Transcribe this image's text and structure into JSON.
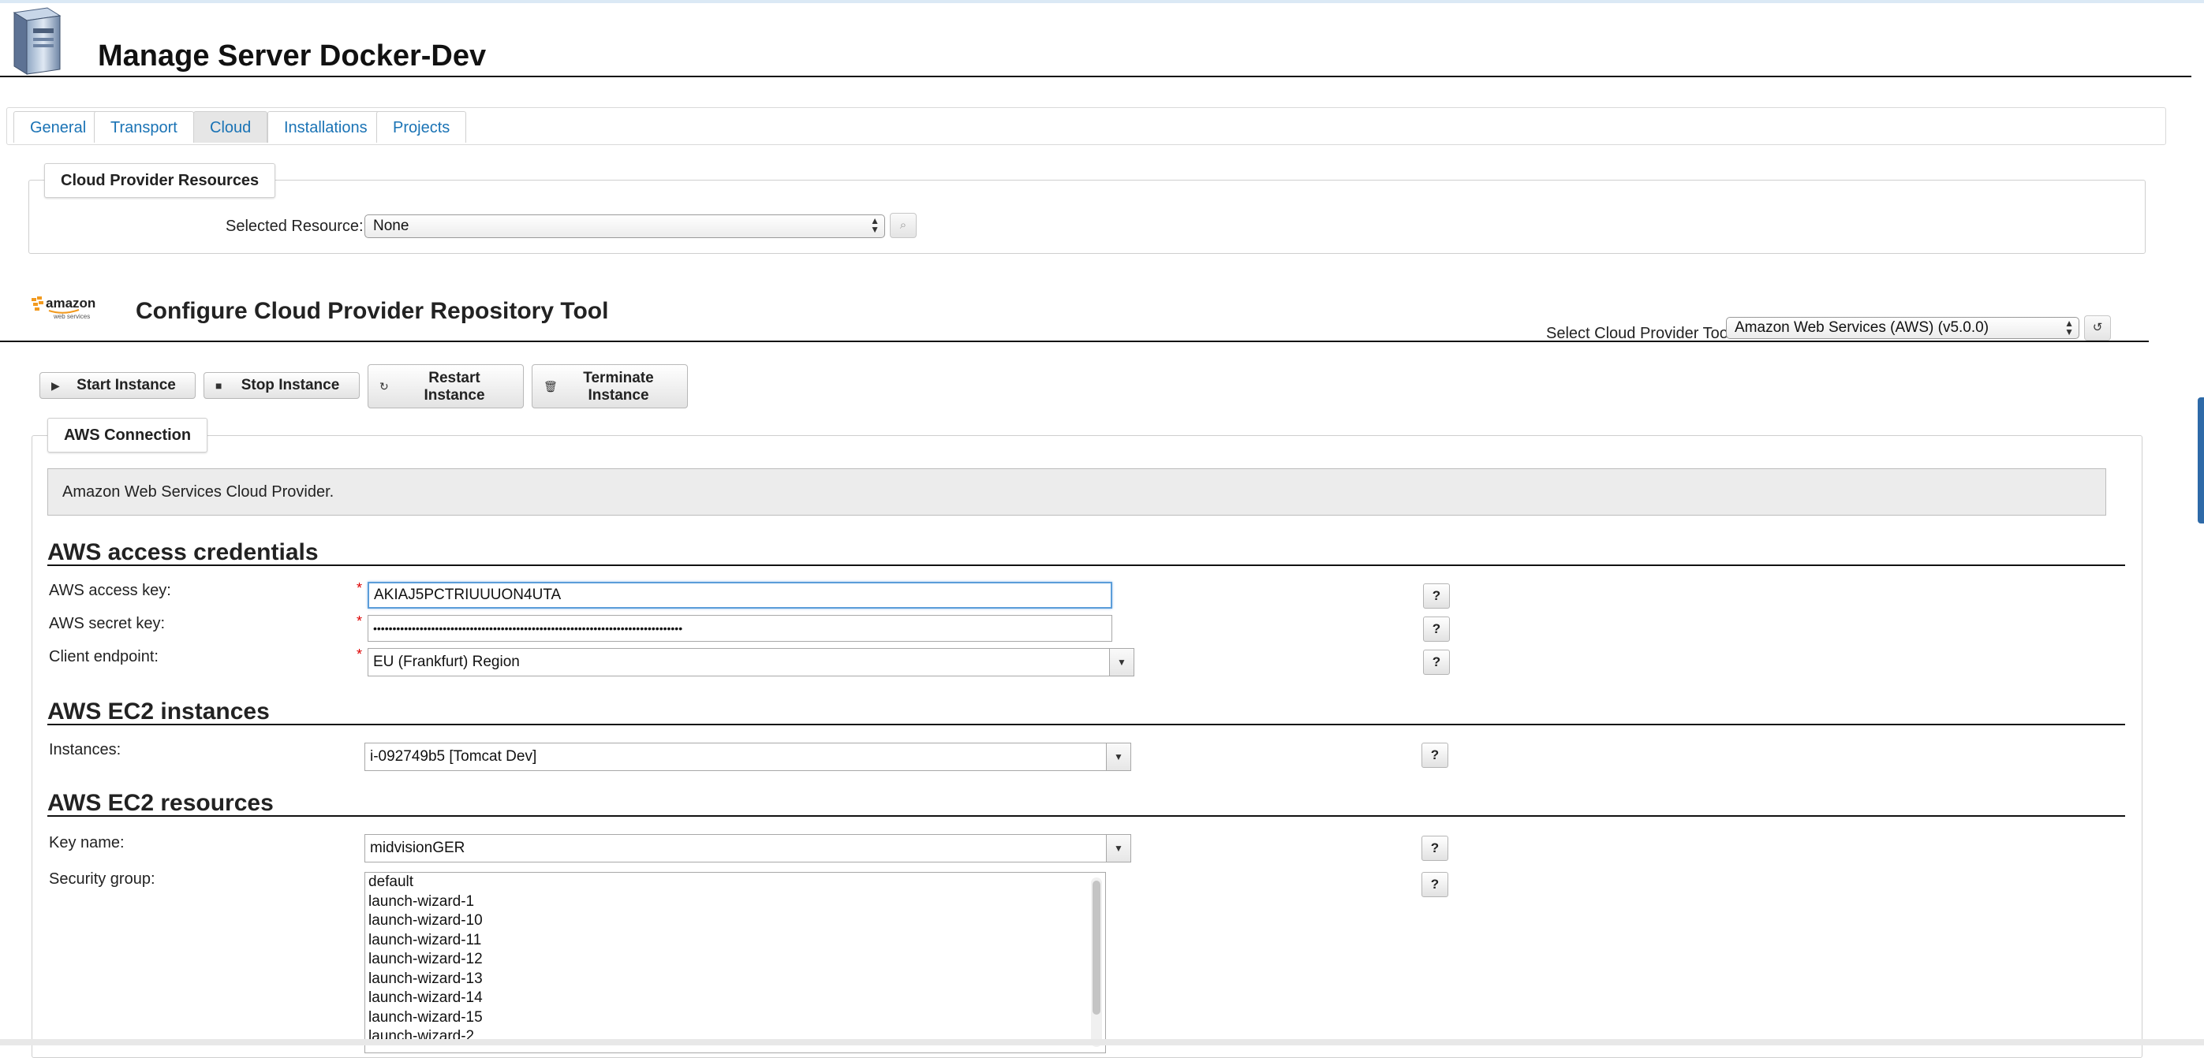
{
  "header": {
    "title": "Manage Server Docker-Dev",
    "icon": "server-icon"
  },
  "tabs": [
    {
      "label": "General",
      "active": false
    },
    {
      "label": "Transport",
      "active": false
    },
    {
      "label": "Cloud",
      "active": true
    },
    {
      "label": "Installations",
      "active": false
    },
    {
      "label": "Projects",
      "active": false
    }
  ],
  "cloud_resources": {
    "legend": "Cloud Provider Resources",
    "selected_label": "Selected Resource:",
    "selected_value": "None"
  },
  "tool": {
    "title": "Configure Cloud Provider Repository Tool",
    "select_label": "Select Cloud Provider Tool",
    "select_value": "Amazon Web Services (AWS) (v5.0.0)",
    "logo_main": "amazon",
    "logo_sub": "web services"
  },
  "actions": {
    "start": "Start Instance",
    "stop": "Stop Instance",
    "restart_1": "Restart",
    "restart_2": "Instance",
    "terminate_1": "Terminate",
    "terminate_2": "Instance"
  },
  "connection": {
    "legend": "AWS Connection",
    "info": "Amazon Web Services Cloud Provider."
  },
  "credentials": {
    "title": "AWS access credentials",
    "access_key_label": "AWS access key:",
    "access_key_value": "AKIAJ5PCTRIUUUON4UTA",
    "secret_key_label": "AWS secret key:",
    "secret_key_value": "••••••••••••••••••••••••••••••••••••••••••••••••••••••••••••••••••••••••••••••••",
    "endpoint_label": "Client endpoint:",
    "endpoint_value": "EU (Frankfurt) Region",
    "required_mark": "*",
    "help": "?"
  },
  "instances": {
    "title": "AWS EC2 instances",
    "label": "Instances:",
    "value": "i-092749b5 [Tomcat Dev]"
  },
  "resources": {
    "title": "AWS EC2 resources",
    "key_label": "Key name:",
    "key_value": "midvisionGER",
    "sg_label": "Security group:",
    "sg_options": [
      "default",
      "launch-wizard-1",
      "launch-wizard-10",
      "launch-wizard-11",
      "launch-wizard-12",
      "launch-wizard-13",
      "launch-wizard-14",
      "launch-wizard-15",
      "launch-wizard-2"
    ]
  }
}
